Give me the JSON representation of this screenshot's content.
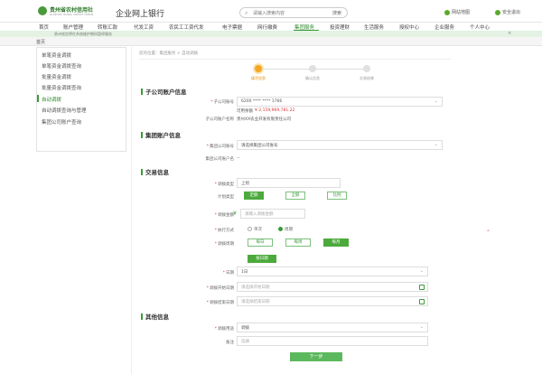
{
  "header": {
    "logo_name": "贵州省农村信用社",
    "logo_en": "GUIZHOU RURAL CREDIT UNION",
    "system_title": "企业网上银行",
    "search_placeholder": "请输入搜索内容",
    "search_button": "搜索",
    "links": [
      "网站地图",
      "安全退出"
    ]
  },
  "nav": {
    "items": [
      "首页",
      "账户管理",
      "转账汇款",
      "代发工资",
      "农民工工资代发",
      "电子票据",
      "网行缴费",
      "集团服务",
      "投资理财",
      "生活服务",
      "授权中心",
      "企业服务",
      "个人中心"
    ],
    "active": "集团服务"
  },
  "notice": {
    "text": "贵州农信将在系统维护期间暂停服务"
  },
  "tabbar": {
    "home": "首页"
  },
  "sidebar": {
    "items": [
      "单笔资金调拨",
      "单笔资金调拨查询",
      "批量资金调拨",
      "批量资金调拨查询",
      "自动调拨",
      "自动调拨查询与管理",
      "集团公司账户查询"
    ],
    "active_index": 4
  },
  "breadcrumb": "您的位置：集团服务 > 自动调拨",
  "steps": [
    {
      "label": "填写信息",
      "active": true
    },
    {
      "label": "确认信息",
      "active": false
    },
    {
      "label": "交易结果",
      "active": false
    }
  ],
  "section_sub": {
    "title": "子公司账户信息",
    "account_label": "子公司账号",
    "account_value": "6200 **** **** 1766",
    "balance_label": "可用余额",
    "balance_value": "¥ 2,159,969,781.22",
    "name_label": "子公司账户名称",
    "name_value": "贵州XX农业开发有限责任公司"
  },
  "section_group": {
    "title": "集团账户信息",
    "account_label": "集团公司账号",
    "account_value": "请选择集团公司账号",
    "name_label": "集团公司账户名",
    "name_value": "--"
  },
  "section_trade": {
    "title": "交易信息",
    "type_label": "调拨类型",
    "type_value": "上划",
    "mode_label": "计划类型",
    "mode_options": [
      "定额",
      "全额",
      "比例"
    ],
    "mode_active": 0,
    "amount_label": "调拨金额",
    "amount_placeholder": "请输入调拨金额",
    "cond_label": "执行方式",
    "cond_options": [
      "单次",
      "周期"
    ],
    "cond_active": 1,
    "freq_label": "调拨周期",
    "freq_options": [
      "每日",
      "每周",
      "每月"
    ],
    "freq_active": 2,
    "freq_sub": "按日期",
    "day_label": "日期",
    "day_value": "1日",
    "start_label": "调拨开始日期",
    "start_placeholder": "请选择开始日期",
    "end_label": "调拨结束日期",
    "end_placeholder": "请选择结束日期"
  },
  "section_other": {
    "title": "其他信息",
    "use_label": "调拨用途",
    "use_value": "调拨",
    "remark_label": "备注",
    "remark_placeholder": "选填"
  },
  "next_button": "下一步"
}
